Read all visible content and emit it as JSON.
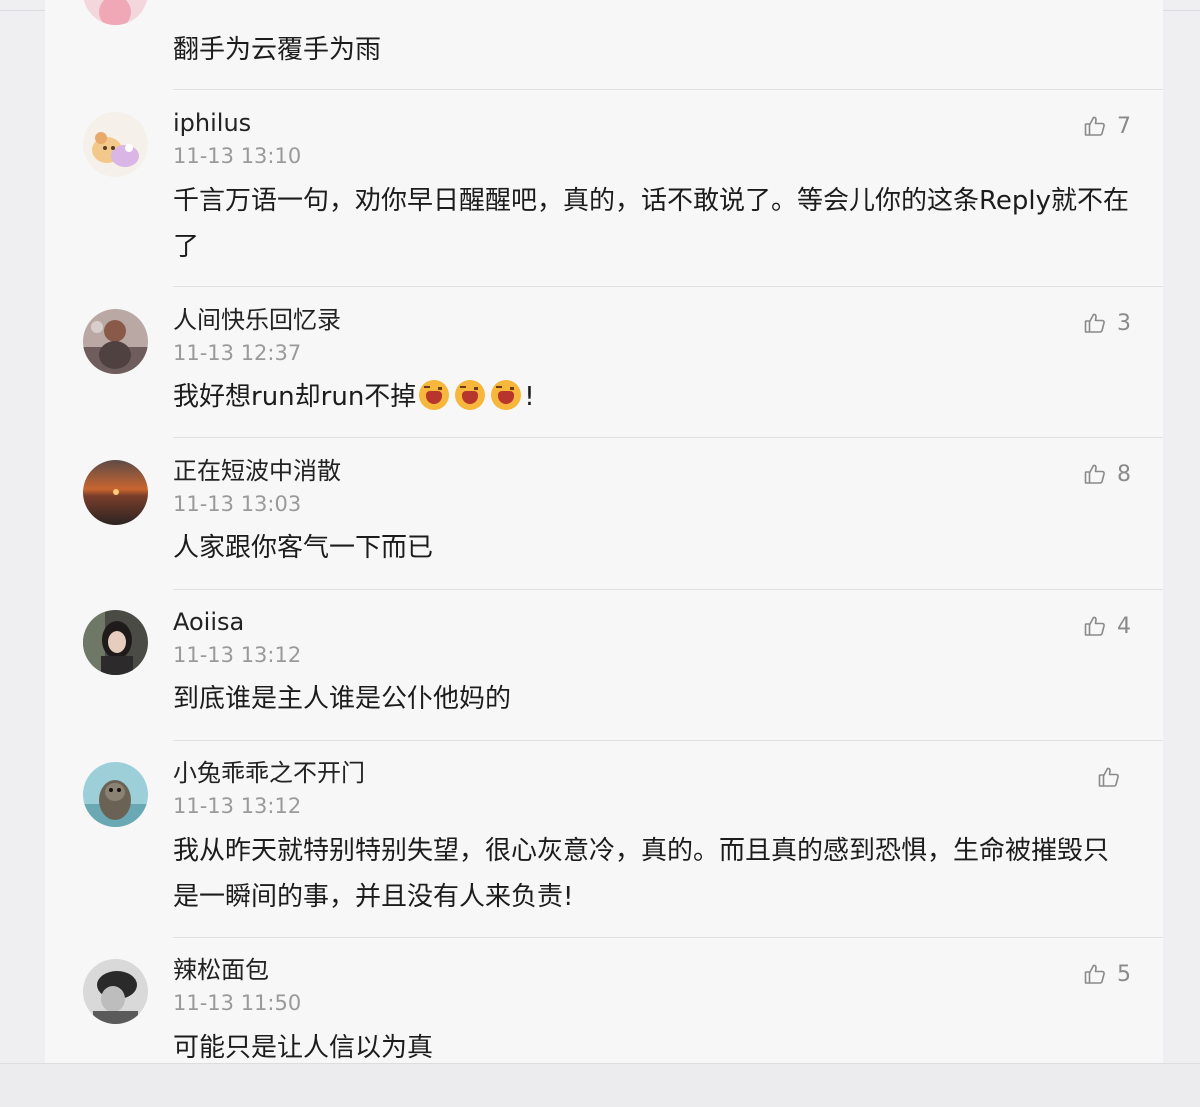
{
  "comments": [
    {
      "username": "",
      "timestamp": "",
      "text": "翻手为云覆手为雨",
      "likes": ""
    },
    {
      "username": "iphilus",
      "timestamp": "11-13 13:10",
      "text": "千言万语一句，劝你早日醒醒吧，真的，话不敢说了。等会儿你的这条Reply就不在了",
      "likes": "7"
    },
    {
      "username": "人间快乐回忆录",
      "timestamp": "11-13 12:37",
      "text_before": "我好想run却run不掉",
      "emoji_name": "crying-face-emoji",
      "text_after": "!",
      "likes": "3"
    },
    {
      "username": "正在短波中消散",
      "timestamp": "11-13 13:03",
      "text": "人家跟你客气一下而已",
      "likes": "8"
    },
    {
      "username": "Aoiisa",
      "timestamp": "11-13 13:12",
      "text": "到底谁是主人谁是公仆他妈的",
      "likes": "4"
    },
    {
      "username": "小兔乖乖之不开门",
      "timestamp": "11-13 13:12",
      "text": "我从昨天就特别特别失望，很心灰意冷，真的。而且真的感到恐惧，生命被摧毁只是一瞬间的事，并且没有人来负责!",
      "likes": ""
    },
    {
      "username": "辣松面包",
      "timestamp": "11-13 11:50",
      "text": "可能只是让人信以为真",
      "likes": "5"
    }
  ],
  "icons": {
    "like": "thumbs-up-outline-icon"
  },
  "colors": {
    "panel_bg": "#f7f7f7",
    "page_bg": "#efeff2",
    "text": "#1c1c1c",
    "muted": "#9a9a9a"
  }
}
